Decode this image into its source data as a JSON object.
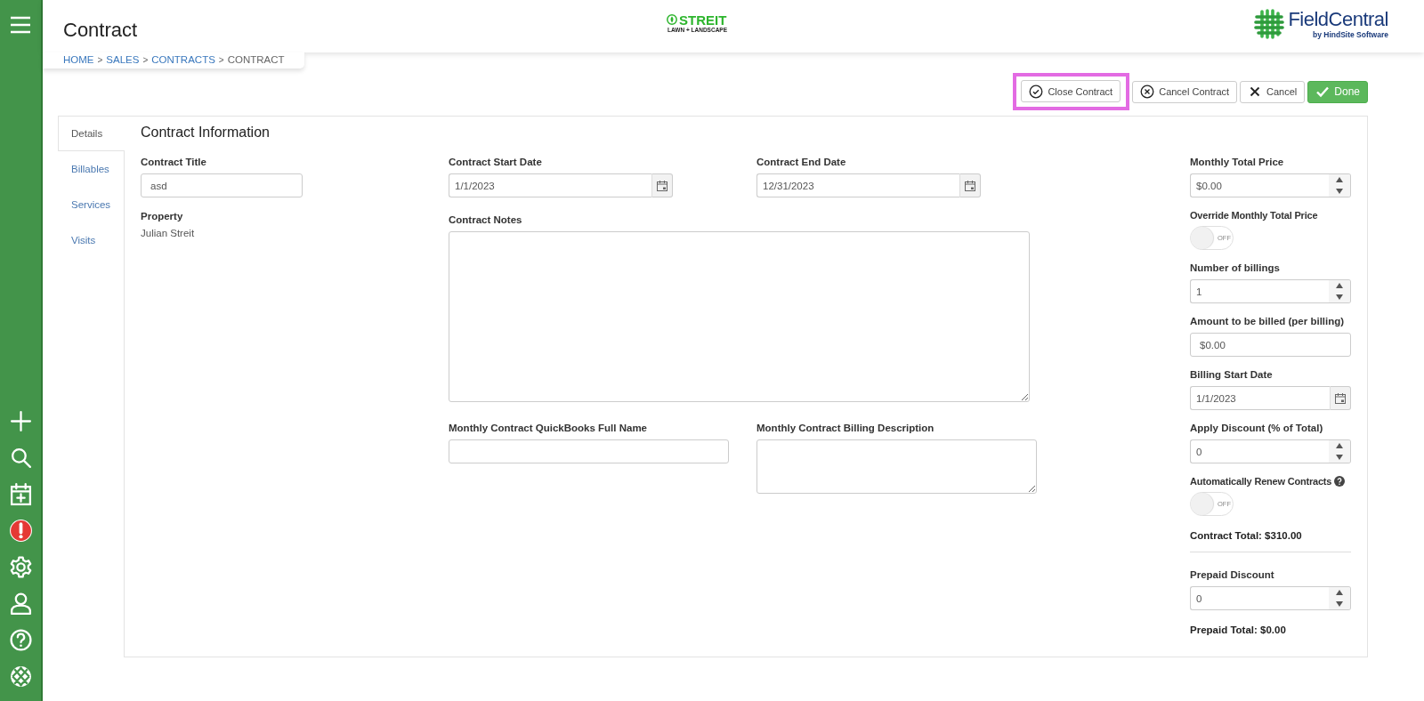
{
  "sidebar": {
    "icons": [
      {
        "kind": "add"
      },
      {
        "kind": "search"
      },
      {
        "kind": "calendar"
      },
      {
        "kind": "alert"
      },
      {
        "kind": "settings"
      },
      {
        "kind": "user"
      },
      {
        "kind": "help"
      },
      {
        "kind": "logo"
      }
    ]
  },
  "header": {
    "title": "Contract",
    "breadcrumb": [
      {
        "label": "HOME",
        "link": true
      },
      {
        "label": "SALES",
        "link": true
      },
      {
        "label": "CONTRACTS",
        "link": true
      },
      {
        "label": "CONTRACT",
        "link": false
      }
    ],
    "separator": ">",
    "center_logo": {
      "name": "STREIT",
      "tagline": "LAWN + LANDSCAPE"
    },
    "brand_logo": {
      "name": "FieldCentral",
      "tagline": "by HindSite Software"
    }
  },
  "actions": [
    {
      "label": "Close Contract",
      "kind": "close",
      "highlighted": true
    },
    {
      "label": "Cancel Contract",
      "kind": "cancel_contract",
      "highlighted": false
    },
    {
      "label": "Cancel",
      "kind": "cancel",
      "highlighted": false
    },
    {
      "label": "Done",
      "kind": "done",
      "highlighted": false
    }
  ],
  "tabs": [
    {
      "label": "Details",
      "selected": true
    },
    {
      "label": "Billables",
      "selected": false
    },
    {
      "label": "Services",
      "selected": false
    },
    {
      "label": "Visits",
      "selected": false
    }
  ],
  "section_title": "Contract Information",
  "form": {
    "contract_title": {
      "label": "Contract Title",
      "value": "asd"
    },
    "property": {
      "label": "Property",
      "value": "Julian Streit"
    },
    "start_date": {
      "label": "Contract Start Date",
      "value": "1/1/2023"
    },
    "end_date": {
      "label": "Contract End Date",
      "value": "12/31/2023"
    },
    "notes": {
      "label": "Contract Notes"
    },
    "quickbooks_name": {
      "label": "Monthly Contract QuickBooks Full Name"
    },
    "billing_description": {
      "label": "Monthly Contract Billing Description"
    }
  },
  "summary": [
    {
      "kind": "number",
      "label": "Monthly Total Price",
      "value": "$0.00"
    },
    {
      "kind": "toggle",
      "label": "Override Monthly Total Price",
      "on": false,
      "state_label": "OFF",
      "help": false
    },
    {
      "kind": "number",
      "label": "Number of billings",
      "value": "1"
    },
    {
      "kind": "text",
      "label": "Amount to be billed (per billing)",
      "value": "$0.00"
    },
    {
      "kind": "date",
      "label": "Billing Start Date",
      "value": "1/1/2023"
    },
    {
      "kind": "number",
      "label": "Apply Discount (% of Total)",
      "value": "0"
    },
    {
      "kind": "toggle",
      "label": "Automatically Renew Contracts",
      "on": false,
      "state_label": "OFF",
      "help": true
    },
    {
      "kind": "total",
      "text": "Contract Total: $310.00"
    }
  ],
  "prepaid": [
    {
      "kind": "number",
      "label": "Prepaid Discount",
      "value": "0"
    },
    {
      "kind": "total",
      "text": "Prepaid Total: $0.00"
    }
  ]
}
